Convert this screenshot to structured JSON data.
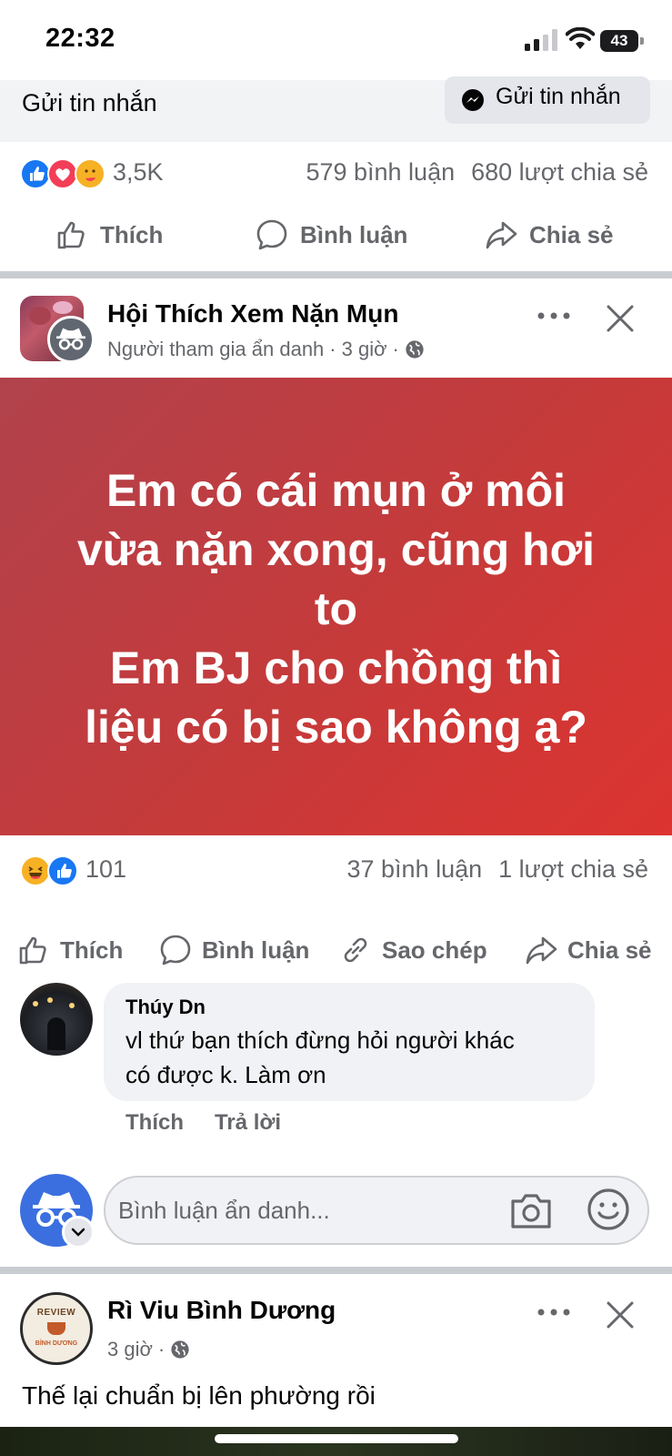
{
  "status_bar": {
    "time": "22:32",
    "battery": "43"
  },
  "top_post": {
    "partial_label": "Gửi tin nhắn",
    "message_button": "Gửi tin nhắn",
    "reaction_count": "3,5K",
    "comments": "579 bình luận",
    "shares": "680 lượt chia sẻ",
    "actions": {
      "like": "Thích",
      "comment": "Bình luận",
      "share": "Chia sẻ"
    }
  },
  "post": {
    "group_name": "Hội Thích Xem Nặn Mụn",
    "author": "Người tham gia ẩn danh",
    "time": "3 giờ",
    "text_lines": [
      "Em có cái mụn ở môi",
      "vừa nặn xong, cũng hơi",
      "to",
      "Em BJ cho chồng thì",
      "liệu có bị sao không ạ?"
    ],
    "reaction_count": "101",
    "comments": "37 bình luận",
    "shares": "1 lượt chia sẻ",
    "actions": {
      "like": "Thích",
      "comment": "Bình luận",
      "copy": "Sao chép",
      "share": "Chia sẻ"
    },
    "comment": {
      "name": "Thúy Dn",
      "text_line1": "vl thứ bạn thích đừng hỏi người khác",
      "text_line2": "có được k. Làm ơn",
      "like": "Thích",
      "reply": "Trả lời"
    },
    "compose_placeholder": "Bình luận ẩn danh..."
  },
  "next_post": {
    "page_name": "Rì Viu Bình Dương",
    "time": "3 giờ",
    "avatar_text_top": "REVIEW",
    "avatar_text_bottom": "BÌNH DƯƠNG",
    "text": "Thế lại chuẩn bị lên phường rồi"
  },
  "colors": {
    "like_blue": "#1877f2",
    "love_red": "#f33e58",
    "banner_red": "#c63a3a",
    "muted": "#65676b"
  },
  "icons": [
    "signal-icon",
    "wifi-icon",
    "battery-icon",
    "messenger-icon",
    "like-icon",
    "comment-icon",
    "share-icon",
    "copy-link-icon",
    "more-icon",
    "close-icon",
    "globe-icon",
    "camera-icon",
    "emoji-icon",
    "chevron-down-icon"
  ]
}
